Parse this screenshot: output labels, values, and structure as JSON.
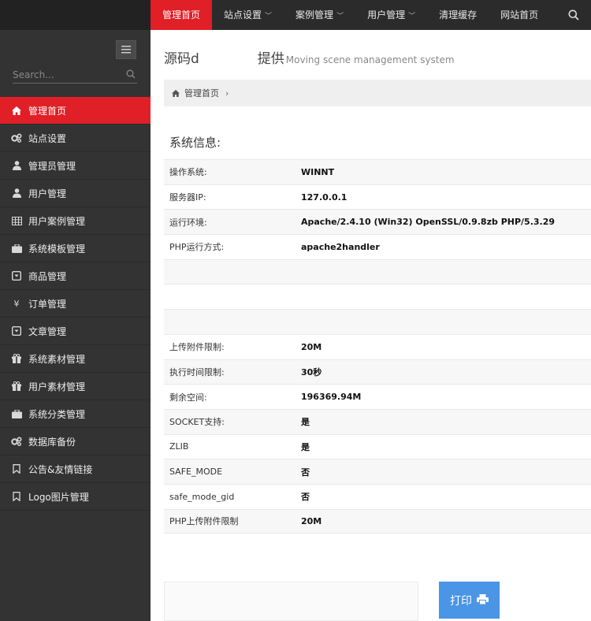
{
  "topnav": {
    "items": [
      {
        "label": "管理首页",
        "caret": ""
      },
      {
        "label": "站点设置",
        "caret": "﹀"
      },
      {
        "label": "案例管理",
        "caret": "﹀"
      },
      {
        "label": "用户管理",
        "caret": "﹀"
      },
      {
        "label": "清理缓存",
        "caret": ""
      },
      {
        "label": "网站首页",
        "caret": ""
      }
    ],
    "active_index": 0
  },
  "sidebar": {
    "search_placeholder": "Search...",
    "items": [
      {
        "label": "管理首页",
        "icon": "home-icon"
      },
      {
        "label": "站点设置",
        "icon": "gears-icon"
      },
      {
        "label": "管理员管理",
        "icon": "user-icon"
      },
      {
        "label": "用户管理",
        "icon": "user-icon"
      },
      {
        "label": "用户案例管理",
        "icon": "table-icon"
      },
      {
        "label": "系统模板管理",
        "icon": "briefcase-icon"
      },
      {
        "label": "商品管理",
        "icon": "caret-square-icon"
      },
      {
        "label": "订单管理",
        "icon": "yen-icon"
      },
      {
        "label": "文章管理",
        "icon": "caret-square-icon"
      },
      {
        "label": "系统素材管理",
        "icon": "gift-icon"
      },
      {
        "label": "用户素材管理",
        "icon": "gift-icon"
      },
      {
        "label": "系统分类管理",
        "icon": "briefcase-icon"
      },
      {
        "label": "数据库备份",
        "icon": "gears-icon"
      },
      {
        "label": "公告&友情链接",
        "icon": "bookmark-icon"
      },
      {
        "label": "Logo图片管理",
        "icon": "bookmark-icon"
      }
    ]
  },
  "main": {
    "title_left": "源码d",
    "title_right": "提供",
    "title_sub": "Moving scene management system",
    "breadcrumb": "管理首页",
    "section_title": "系统信息:",
    "info_rows": [
      {
        "k": "操作系统:",
        "v": "WINNT"
      },
      {
        "k": "服务器IP:",
        "v": "127.0.0.1"
      },
      {
        "k": "运行环境:",
        "v": "Apache/2.4.10 (Win32) OpenSSL/0.9.8zb PHP/5.3.29"
      },
      {
        "k": "PHP运行方式:",
        "v": "apache2handler"
      },
      {
        "k": "",
        "v": ""
      },
      {
        "k": "",
        "v": ""
      },
      {
        "k": "",
        "v": ""
      },
      {
        "k": "上传附件限制:",
        "v": "20M"
      },
      {
        "k": "执行时间限制:",
        "v": "30秒"
      },
      {
        "k": "剩余空间:",
        "v": "196369.94M"
      },
      {
        "k": "SOCKET支持:",
        "v": "是"
      },
      {
        "k": "ZLIB",
        "v": "是"
      },
      {
        "k": "SAFE_MODE",
        "v": "否"
      },
      {
        "k": "safe_mode_gid",
        "v": "否"
      },
      {
        "k": "PHP上传附件限制",
        "v": "20M"
      }
    ],
    "print_label": "打印"
  },
  "colors": {
    "accent": "#e01f26",
    "sidebar": "#333333",
    "print": "#4a95e6"
  }
}
